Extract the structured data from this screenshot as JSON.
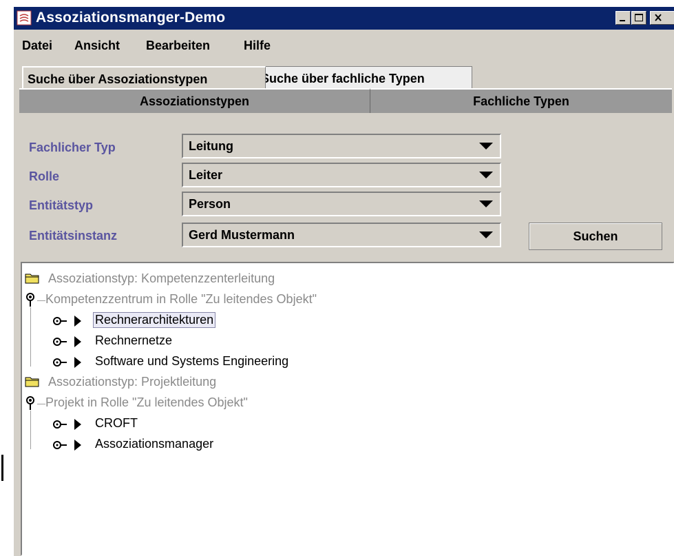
{
  "window": {
    "title": "Assoziationsmanger-Demo"
  },
  "menu": [
    "Datei",
    "Ansicht",
    "Bearbeiten",
    "Hilfe"
  ],
  "tabs_top": [
    "Suche über Assoziationstypen",
    "Suche über fachliche Typen"
  ],
  "tabs_sub": [
    "Assoziationstypen",
    "Fachliche Typen"
  ],
  "form": {
    "fields": [
      {
        "label": "Fachlicher Typ",
        "value": "Leitung"
      },
      {
        "label": "Rolle",
        "value": "Leiter"
      },
      {
        "label": "Entitätstyp",
        "value": "Person"
      },
      {
        "label": "Entitätsinstanz",
        "value": "Gerd Mustermann"
      }
    ],
    "search_button": "Suchen"
  },
  "tree": {
    "groups": [
      {
        "folder": "Assoziationstyp: Kompetenzzenterleitung",
        "role": "Kompetenzzentrum in Rolle \"Zu leitendes Objekt\"",
        "items": [
          "Rechnerarchitekturen",
          "Rechnernetze",
          "Software und Systems Engineering"
        ]
      },
      {
        "folder": "Assoziationstyp: Projektleitung",
        "role": "Projekt in Rolle \"Zu leitendes Objekt\"",
        "items": [
          "CROFT",
          "Assoziationsmanager"
        ]
      }
    ]
  },
  "colors": {
    "titlebar": "#0a246a",
    "label": "#5a55a0",
    "tree_grey": "#8a8a8a"
  }
}
